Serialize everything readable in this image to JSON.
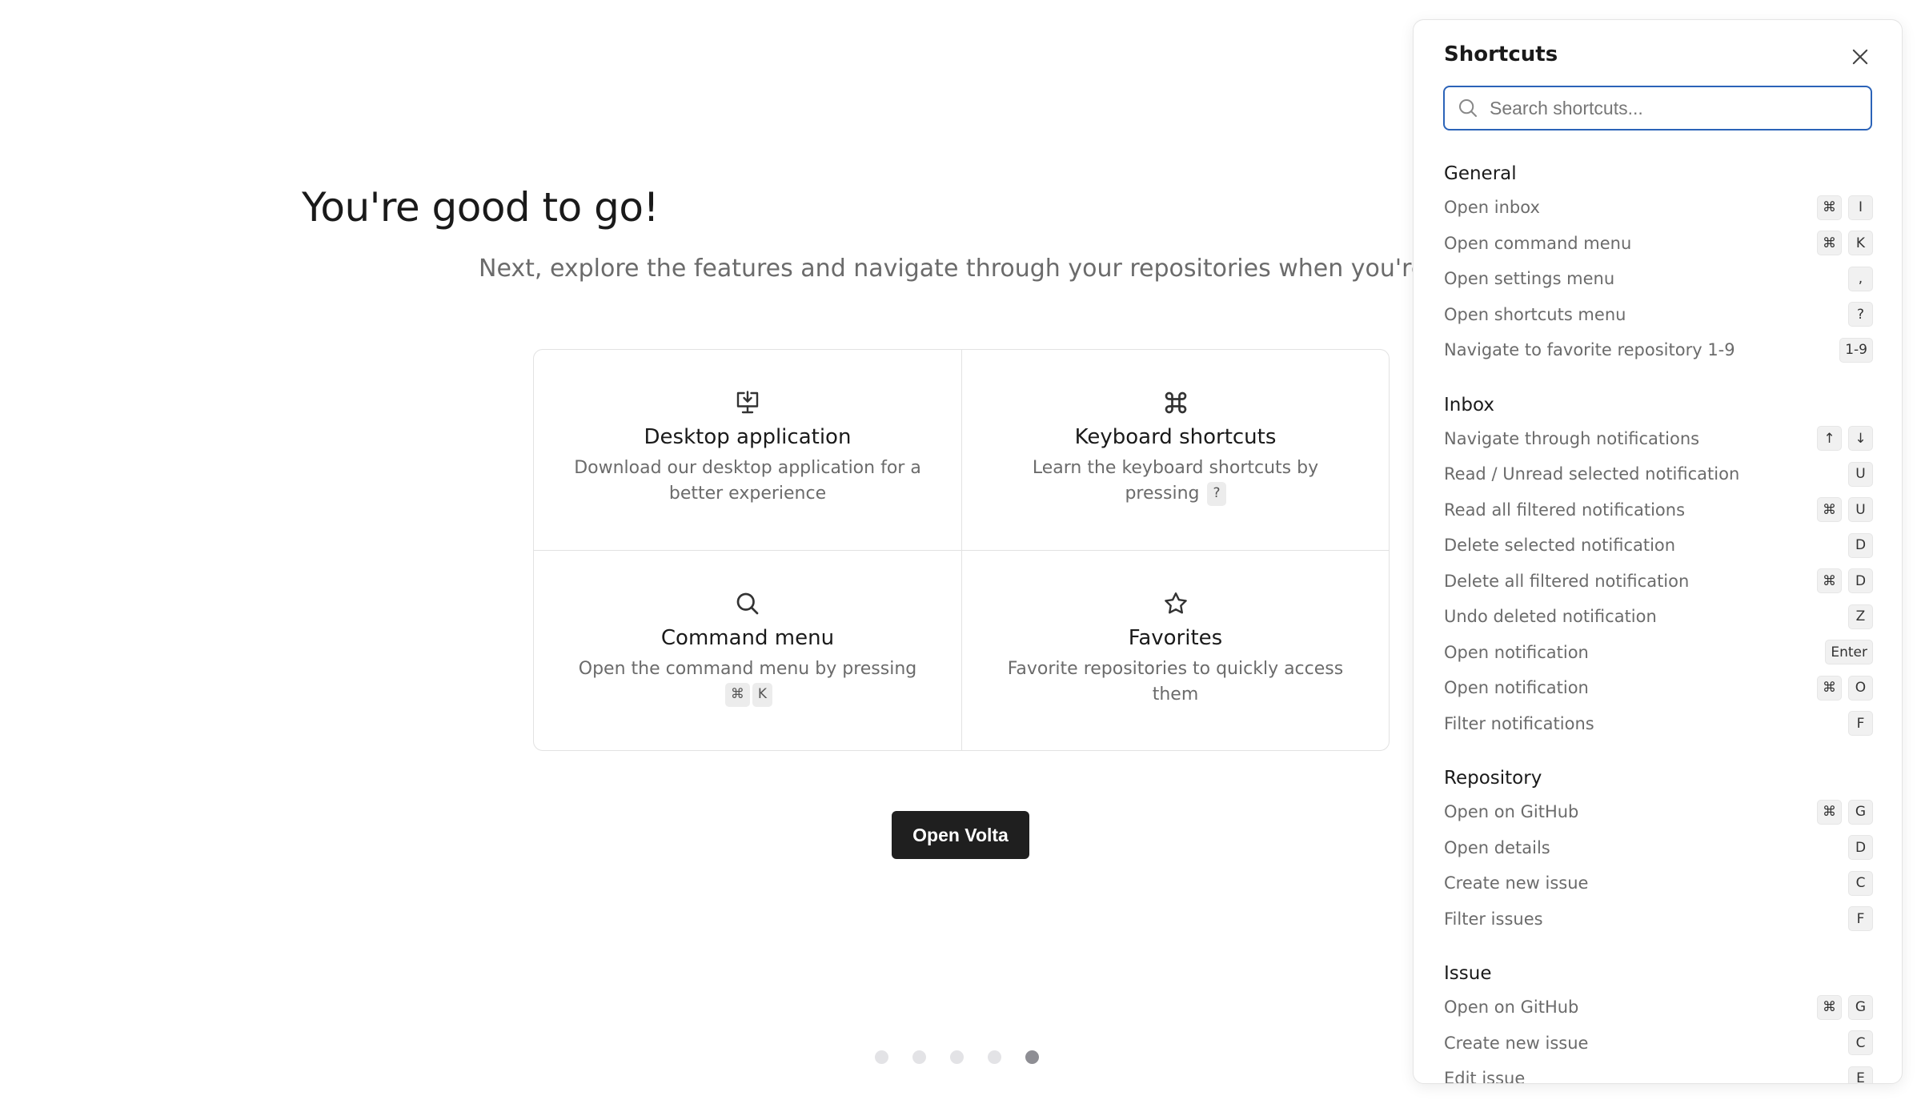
{
  "hero": {
    "title": "You're good to go!",
    "subtitle": "Next, explore the features and navigate through your repositories when you're in the ap"
  },
  "cards": [
    {
      "icon": "download-desktop-icon",
      "title": "Desktop application",
      "desc": "Download our desktop application for a better experience"
    },
    {
      "icon": "command-key-icon",
      "title": "Keyboard shortcuts",
      "desc": "Learn the keyboard shortcuts by pressing",
      "keys": [
        "?"
      ]
    },
    {
      "icon": "search-icon",
      "title": "Command menu",
      "desc": "Open the command menu by pressing",
      "keys": [
        "⌘",
        "K"
      ]
    },
    {
      "icon": "star-icon",
      "title": "Favorites",
      "desc": "Favorite repositories to quickly access them"
    }
  ],
  "primary_button": "Open Volta",
  "pagination": {
    "total": 5,
    "active": 5
  },
  "shortcuts_panel": {
    "title": "Shortcuts",
    "search_placeholder": "Search shortcuts...",
    "groups": [
      {
        "title": "General",
        "items": [
          {
            "label": "Open inbox",
            "keys": [
              "⌘",
              "I"
            ]
          },
          {
            "label": "Open command menu",
            "keys": [
              "⌘",
              "K"
            ]
          },
          {
            "label": "Open settings menu",
            "keys": [
              ","
            ]
          },
          {
            "label": "Open shortcuts menu",
            "keys": [
              "?"
            ]
          },
          {
            "label": "Navigate to favorite repository 1-9",
            "keys": [
              "1-9"
            ]
          }
        ]
      },
      {
        "title": "Inbox",
        "items": [
          {
            "label": "Navigate through notifications",
            "keys": [
              "↑",
              "↓"
            ]
          },
          {
            "label": "Read / Unread selected notification",
            "keys": [
              "U"
            ]
          },
          {
            "label": "Read all filtered notifications",
            "keys": [
              "⌘",
              "U"
            ]
          },
          {
            "label": "Delete selected notification",
            "keys": [
              "D"
            ]
          },
          {
            "label": "Delete all filtered notification",
            "keys": [
              "⌘",
              "D"
            ]
          },
          {
            "label": "Undo deleted notification",
            "keys": [
              "Z"
            ]
          },
          {
            "label": "Open notification",
            "keys": [
              "Enter"
            ]
          },
          {
            "label": "Open notification",
            "keys": [
              "⌘",
              "O"
            ]
          },
          {
            "label": "Filter notifications",
            "keys": [
              "F"
            ]
          }
        ]
      },
      {
        "title": "Repository",
        "items": [
          {
            "label": "Open on GitHub",
            "keys": [
              "⌘",
              "G"
            ]
          },
          {
            "label": "Open details",
            "keys": [
              "D"
            ]
          },
          {
            "label": "Create new issue",
            "keys": [
              "C"
            ]
          },
          {
            "label": "Filter issues",
            "keys": [
              "F"
            ]
          }
        ]
      },
      {
        "title": "Issue",
        "items": [
          {
            "label": "Open on GitHub",
            "keys": [
              "⌘",
              "G"
            ]
          },
          {
            "label": "Create new issue",
            "keys": [
              "C"
            ]
          },
          {
            "label": "Edit issue",
            "keys": [
              "E"
            ]
          }
        ]
      }
    ]
  }
}
